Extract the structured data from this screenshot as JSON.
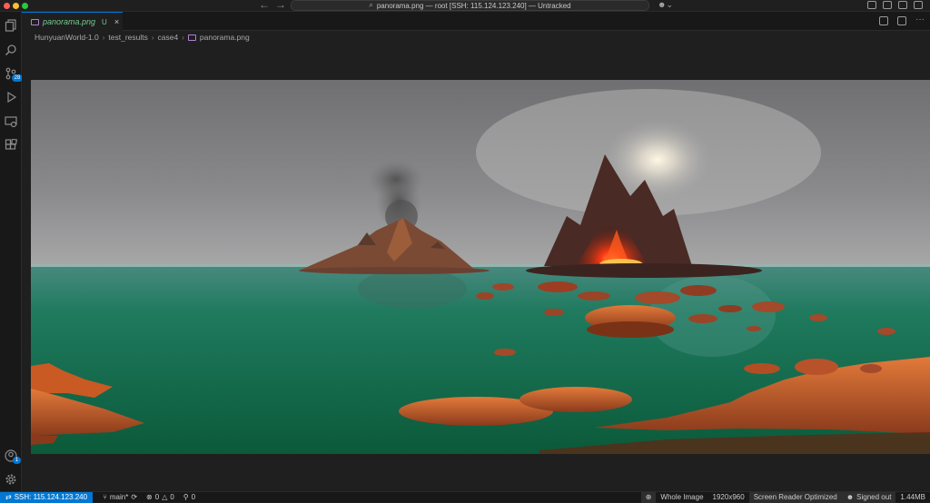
{
  "window": {
    "title": "panorama.png — root [SSH: 115.124.123.240] — Untracked"
  },
  "tab": {
    "name": "panorama.png",
    "status": "U",
    "close": "×"
  },
  "breadcrumb": [
    "HunyuanWorld-1.0",
    "test_results",
    "case4",
    "panorama.png"
  ],
  "activity": {
    "source_control_badge": "28",
    "account_badge": "1"
  },
  "statusbar": {
    "remote": "SSH: 115.124.123.240",
    "branch": "main*",
    "errors": "0",
    "warnings": "0",
    "ports": "0",
    "zoom": "Whole Image",
    "dimensions": "1920x960",
    "screen_reader": "Screen Reader Optimized",
    "signed": "Signed out",
    "size": "1.44MB"
  },
  "colors": {
    "accent": "#0078d4",
    "untracked": "#73c991"
  }
}
